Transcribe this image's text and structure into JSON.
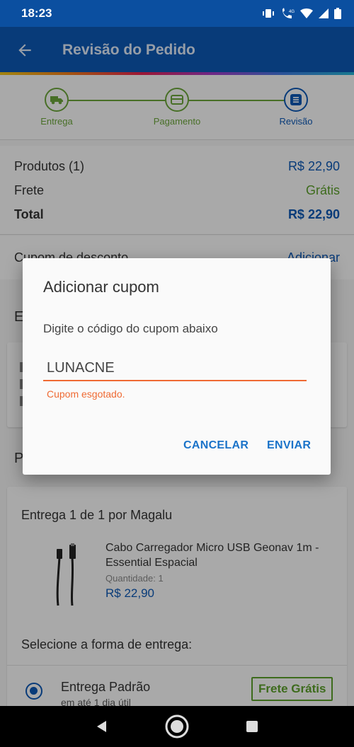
{
  "status_bar": {
    "time": "18:23"
  },
  "app_bar": {
    "title": "Revisão do Pedido"
  },
  "steps": [
    {
      "label": "Entrega",
      "icon": "truck-icon"
    },
    {
      "label": "Pagamento",
      "icon": "card-icon"
    },
    {
      "label": "Revisão",
      "icon": "list-icon"
    }
  ],
  "summary": {
    "products_label": "Produtos (1)",
    "products_value": "R$ 22,90",
    "shipping_label": "Frete",
    "shipping_value": "Grátis",
    "total_label": "Total",
    "total_value": "R$ 22,90"
  },
  "coupon_row": {
    "label": "Cupom de desconto",
    "action": "Adicionar"
  },
  "section_e": {
    "letter": "E"
  },
  "section_p": {
    "letter": "P"
  },
  "delivery": {
    "title": "Entrega 1 de 1 por Magalu",
    "product_name": "Cabo Carregador Micro USB Geonav 1m - Essential Espacial",
    "quantity": "Quantidade: 1",
    "price": "R$ 22,90",
    "choose_label": "Selecione a forma de entrega:",
    "option_name": "Entrega Padrão",
    "option_sub": "em até 1 dia útil",
    "option_badge": "Frete Grátis"
  },
  "dialog": {
    "title": "Adicionar cupom",
    "message": "Digite o código do cupom abaixo",
    "input_value": "LUNACNE",
    "error": "Cupom esgotado.",
    "cancel_label": "CANCELAR",
    "send_label": "ENVIAR"
  },
  "colors": {
    "primary": "#0d57b3",
    "success": "#5a9e2a",
    "error": "#ef6a33",
    "link": "#1a73c9"
  }
}
